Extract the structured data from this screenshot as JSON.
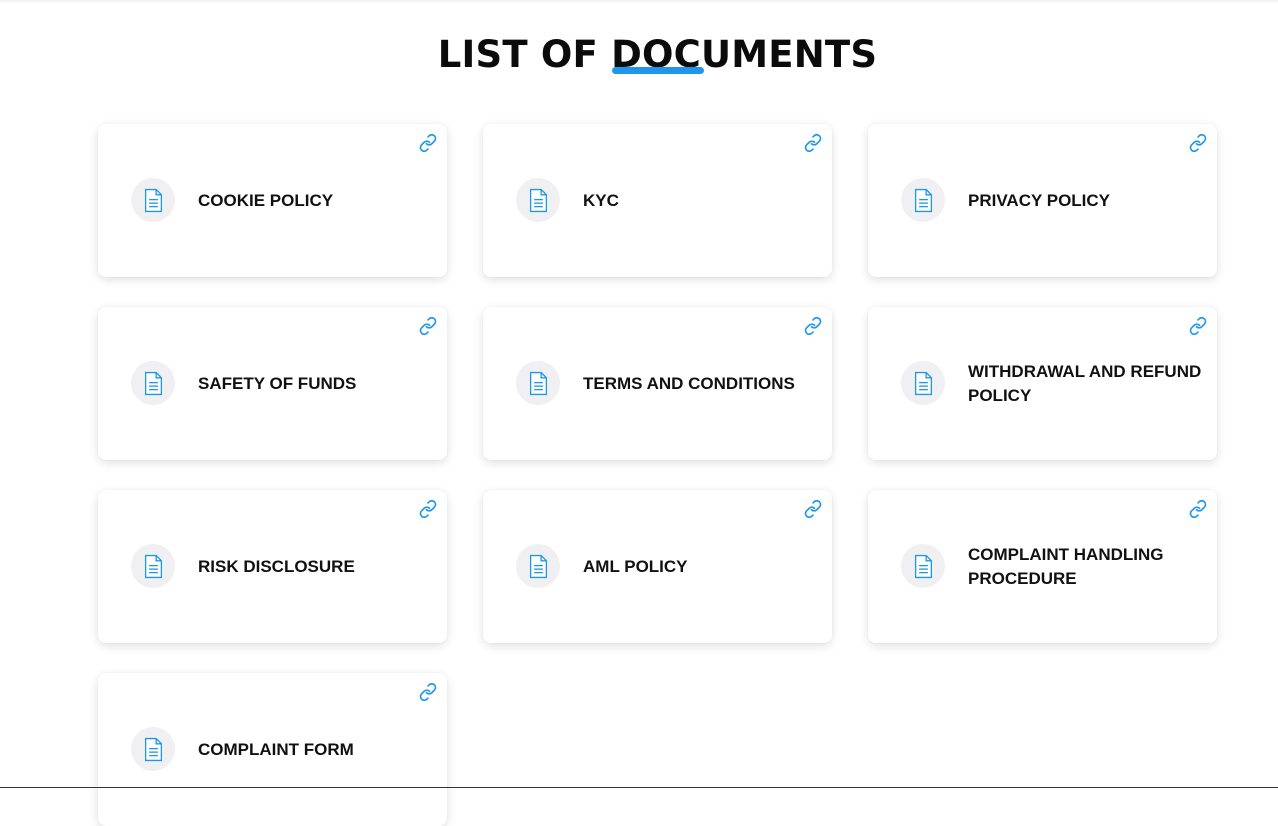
{
  "page": {
    "title": "LIST OF DOCUMENTS"
  },
  "theme": {
    "accent": "#1e97e8"
  },
  "documents": [
    {
      "label": "COOKIE POLICY",
      "icon": "document-icon",
      "link_icon": "link-icon"
    },
    {
      "label": "KYC",
      "icon": "document-icon",
      "link_icon": "link-icon"
    },
    {
      "label": "PRIVACY POLICY",
      "icon": "document-icon",
      "link_icon": "link-icon"
    },
    {
      "label": "SAFETY OF FUNDS",
      "icon": "document-icon",
      "link_icon": "link-icon"
    },
    {
      "label": "TERMS AND CONDITIONS",
      "icon": "document-icon",
      "link_icon": "link-icon"
    },
    {
      "label": "WITHDRAWAL AND REFUND POLICY",
      "icon": "document-icon",
      "link_icon": "link-icon"
    },
    {
      "label": "RISK DISCLOSURE",
      "icon": "document-icon",
      "link_icon": "link-icon"
    },
    {
      "label": "AML POLICY",
      "icon": "document-icon",
      "link_icon": "link-icon"
    },
    {
      "label": "COMPLAINT HANDLING PROCEDURE",
      "icon": "document-icon",
      "link_icon": "link-icon"
    },
    {
      "label": "COMPLAINT FORM",
      "icon": "document-icon",
      "link_icon": "link-icon"
    }
  ]
}
